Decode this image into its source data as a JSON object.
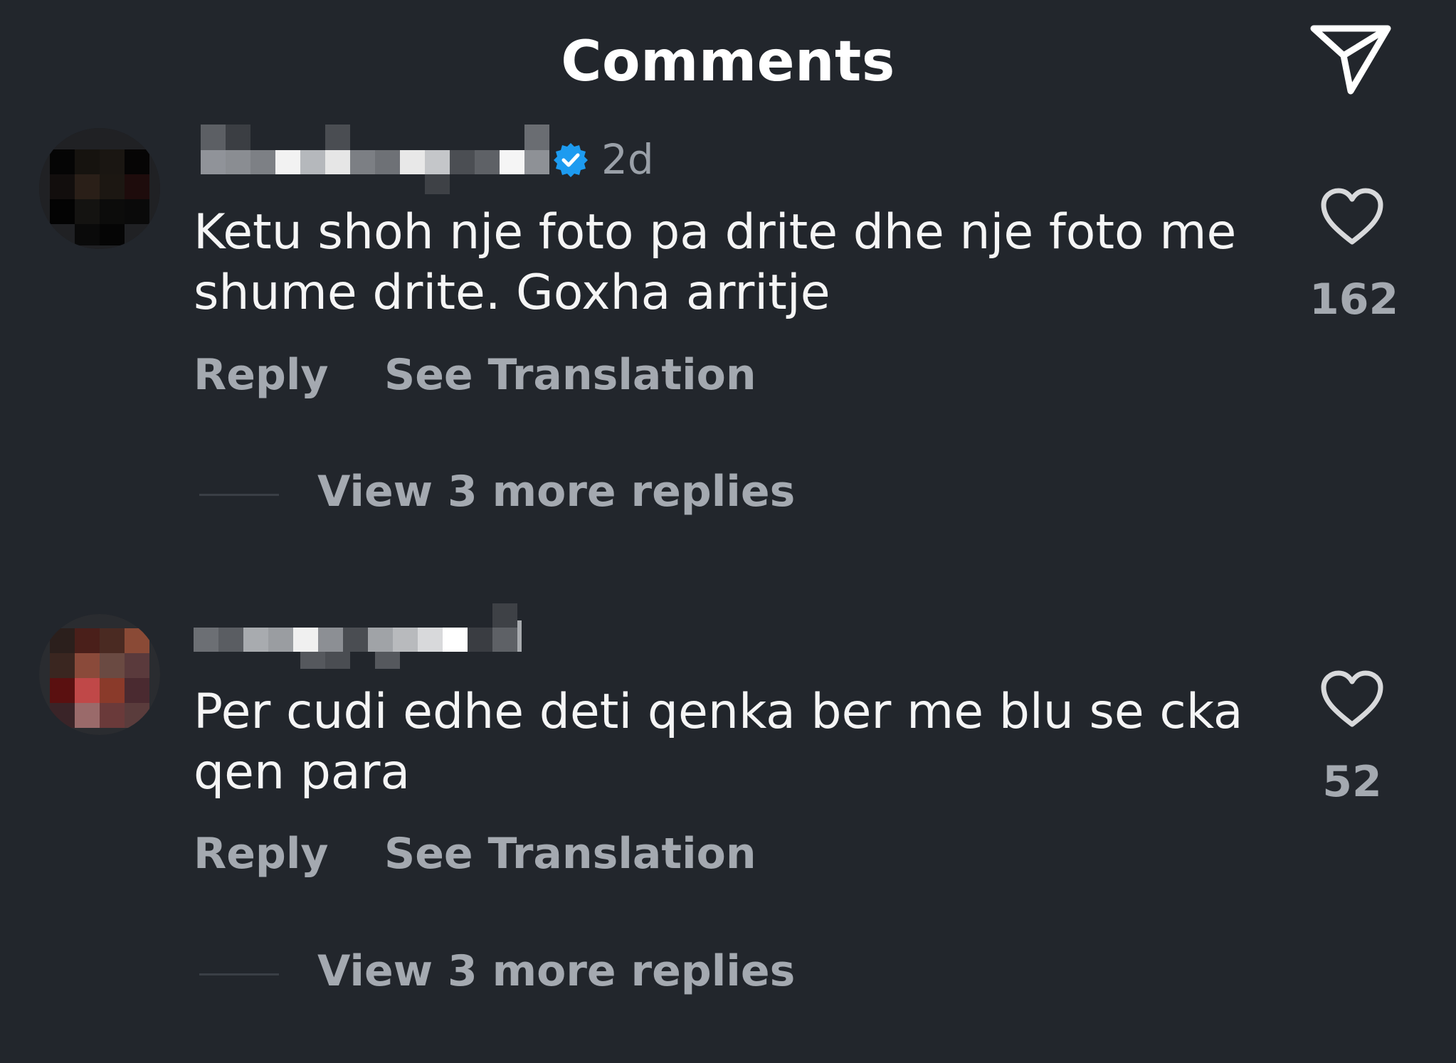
{
  "header": {
    "title": "Comments",
    "share_icon": "paper-plane-icon"
  },
  "comments": [
    {
      "username": "",
      "verified": true,
      "time": "2d",
      "text": "Ketu shoh nje foto pa drite dhe nje foto me shume drite. Goxha arritje",
      "reply_label": "Reply",
      "translate_label": "See Translation",
      "like_count": "162",
      "view_replies_label": "View 3 more replies"
    },
    {
      "username": "",
      "verified": false,
      "time": "",
      "text": "Per cudi edhe deti qenka ber me blu se cka qen para",
      "reply_label": "Reply",
      "translate_label": "See Translation",
      "like_count": "52",
      "view_replies_label": "View 3 more replies"
    }
  ],
  "colors": {
    "background": "#22262c",
    "text_primary": "#f5f5f5",
    "text_secondary": "#a4a9b0",
    "verified_blue": "#1d9bf0"
  }
}
